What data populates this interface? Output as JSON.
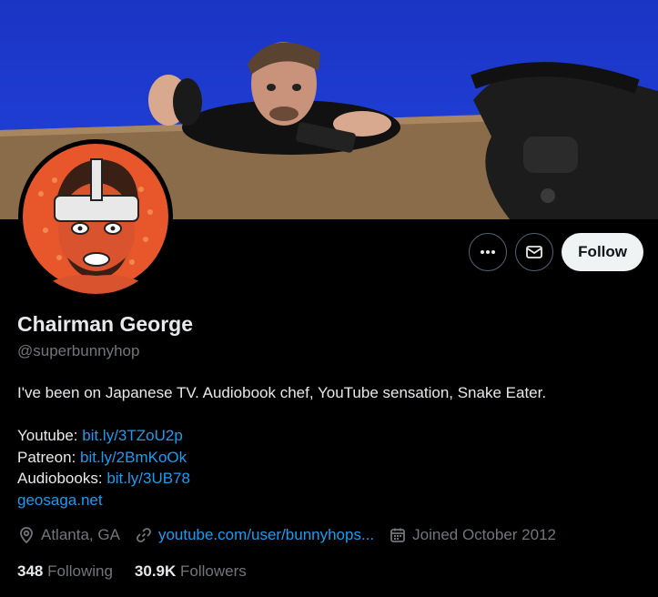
{
  "profile": {
    "name": "Chairman George",
    "handle": "@superbunnyhop",
    "bio_text": "I've been on Japanese TV. Audiobook chef, YouTube sensation, Snake Eater.",
    "links": [
      {
        "label": "Youtube:",
        "url": "bit.ly/3TZoU2p"
      },
      {
        "label": "Patreon:",
        "url": "bit.ly/2BmKoOk"
      },
      {
        "label": "Audiobooks:",
        "url": "bit.ly/3UB78"
      }
    ],
    "website_line": "geosaga.net",
    "location": "Atlanta, GA",
    "meta_link": "youtube.com/user/bunnyhops...",
    "joined": "Joined October 2012",
    "following_count": "348",
    "following_label": "Following",
    "followers_count": "30.9K",
    "followers_label": "Followers"
  },
  "actions": {
    "follow_label": "Follow"
  },
  "icons": {
    "more": "more-icon",
    "message": "envelope-icon",
    "location": "location-pin-icon",
    "link": "link-icon",
    "calendar": "calendar-icon"
  },
  "colors": {
    "background": "#000000",
    "link": "#1d9bf0",
    "secondary_text": "#71767b",
    "banner_blue": "#1e3bd0"
  }
}
